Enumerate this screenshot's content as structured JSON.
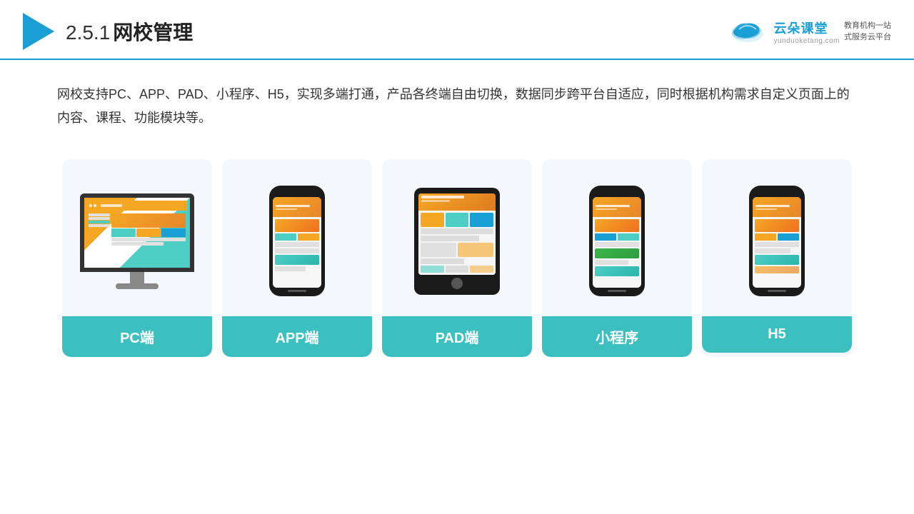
{
  "header": {
    "section_num": "2.5.1",
    "title": "网校管理"
  },
  "brand": {
    "name": "云朵课堂",
    "url": "yunduoketang.com",
    "tagline_line1": "教育机构一站",
    "tagline_line2": "式服务云平台"
  },
  "description": "网校支持PC、APP、PAD、小程序、H5，实现多端打通，产品各终端自由切换，数据同步跨平台自适应，同时根据机构需求自定义页面上的内容、课程、功能模块等。",
  "cards": [
    {
      "id": "pc",
      "label": "PC端"
    },
    {
      "id": "app",
      "label": "APP端"
    },
    {
      "id": "pad",
      "label": "PAD端"
    },
    {
      "id": "miniprogram",
      "label": "小程序"
    },
    {
      "id": "h5",
      "label": "H5"
    }
  ]
}
